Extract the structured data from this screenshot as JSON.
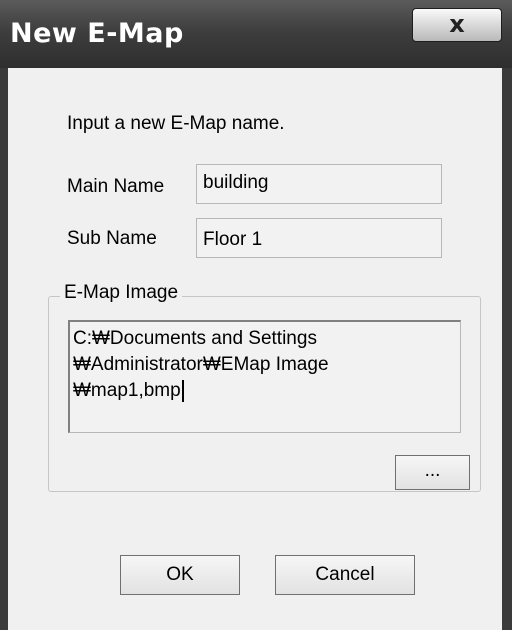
{
  "window": {
    "title": "New E-Map",
    "close_label": "x"
  },
  "instruction": "Input a new E-Map name.",
  "main_name": {
    "label": "Main Name",
    "value": "building"
  },
  "sub_name": {
    "label": "Sub Name",
    "value": "Floor 1"
  },
  "emap_image": {
    "group_label": "E-Map Image",
    "path_lines": [
      "C:₩Documents and Settings",
      "₩Administrator₩EMap Image",
      "₩map1,bmp"
    ],
    "browse_label": "..."
  },
  "buttons": {
    "ok": "OK",
    "cancel": "Cancel"
  }
}
